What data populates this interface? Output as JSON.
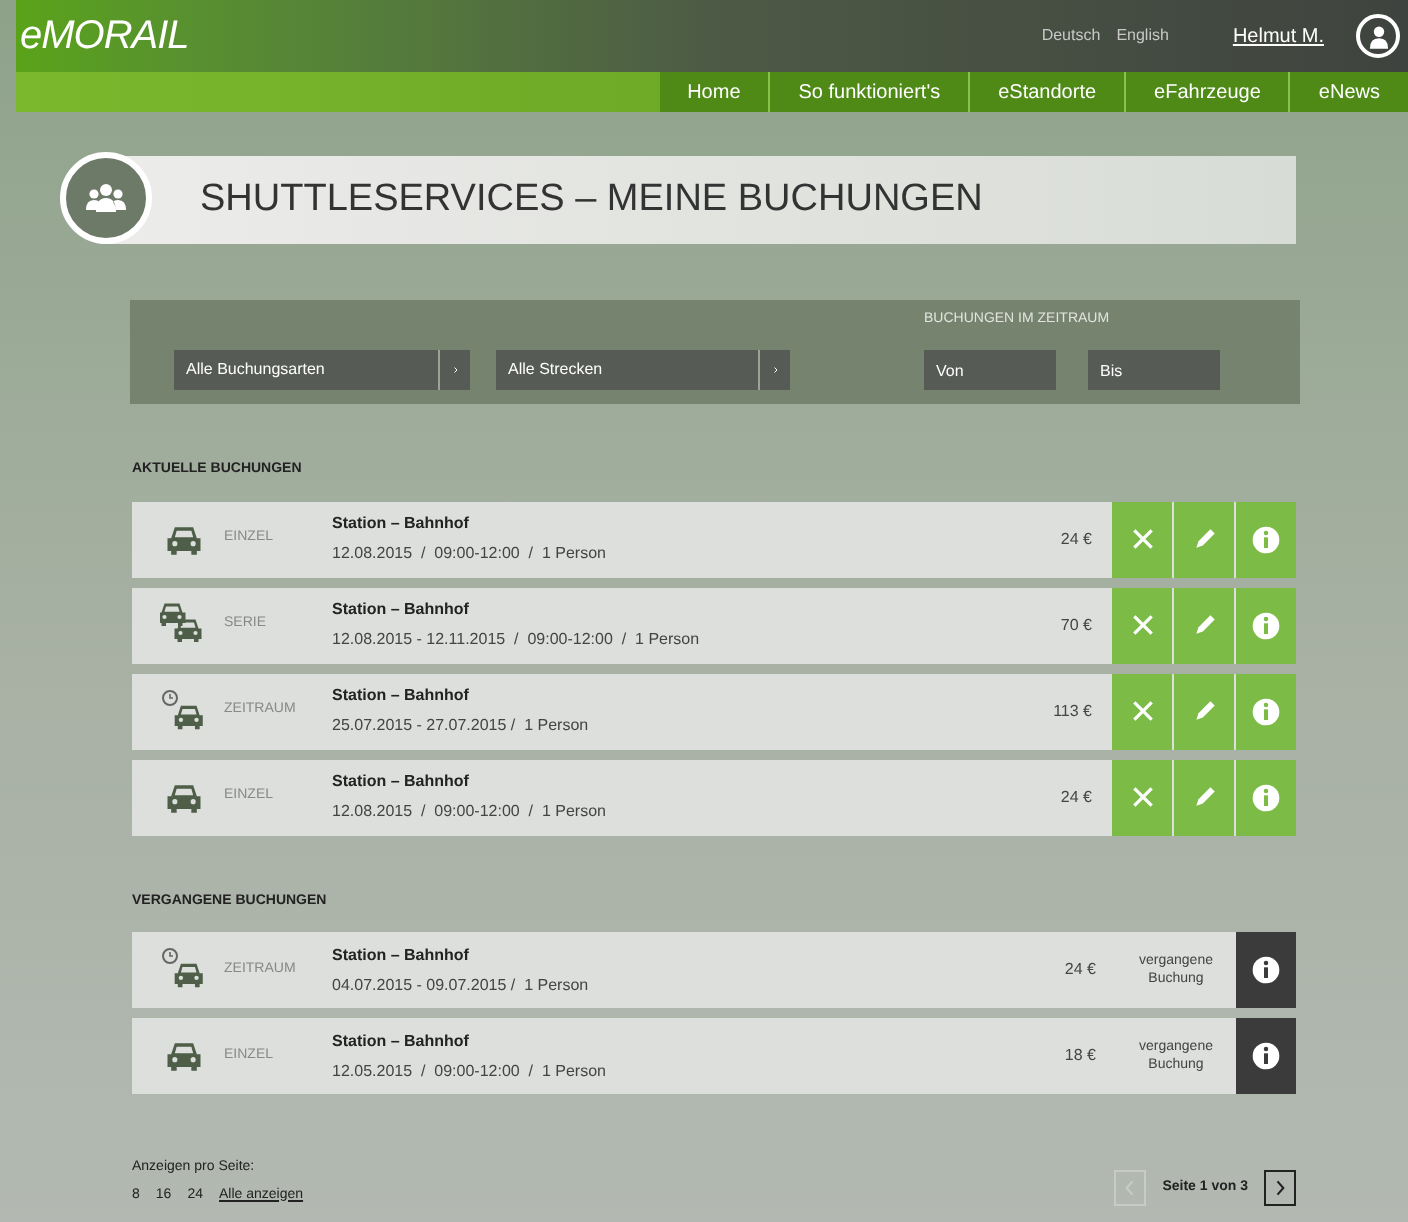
{
  "header": {
    "logo": "eMORAIL",
    "languages": [
      "Deutsch",
      "English"
    ],
    "user": "Helmut M."
  },
  "nav": [
    "Home",
    "So funktioniert's",
    "eStandorte",
    "eFahrzeuge",
    "eNews"
  ],
  "page_title": "SHUTTLESERVICES – MEINE BUCHUNGEN",
  "filters": {
    "booking_type": "Alle Buchungsarten",
    "route": "Alle Strecken",
    "period_label": "BUCHUNGEN IM ZEITRAUM",
    "from_placeholder": "Von",
    "to_placeholder": "Bis"
  },
  "current_bookings": {
    "heading": "AKTUELLE BUCHUNGEN",
    "rows": [
      {
        "kind": "einzel",
        "type": "EINZEL",
        "route": "Station – Bahnhof",
        "details": "12.08.2015  /  09:00-12:00  /  1 Person",
        "price": "24 €"
      },
      {
        "kind": "serie",
        "type": "SERIE",
        "route": "Station – Bahnhof",
        "details": "12.08.2015 - 12.11.2015  /  09:00-12:00  /  1 Person",
        "price": "70 €"
      },
      {
        "kind": "zeitraum",
        "type": "ZEITRAUM",
        "route": "Station – Bahnhof",
        "details": "25.07.2015 - 27.07.2015 /  1 Person",
        "price": "113 €"
      },
      {
        "kind": "einzel",
        "type": "EINZEL",
        "route": "Station – Bahnhof",
        "details": "12.08.2015  /  09:00-12:00  /  1 Person",
        "price": "24 €"
      }
    ]
  },
  "past_bookings": {
    "heading": "VERGANGENE BUCHUNGEN",
    "rows": [
      {
        "kind": "zeitraum",
        "type": "ZEITRAUM",
        "route": "Station – Bahnhof",
        "details": "04.07.2015 - 09.07.2015 /  1 Person",
        "price": "24 €",
        "status": "vergangene Buchung"
      },
      {
        "kind": "einzel",
        "type": "EINZEL",
        "route": "Station – Bahnhof",
        "details": "12.05.2015  /  09:00-12:00  /  1 Person",
        "price": "18 €",
        "status": "vergangene Buchung"
      }
    ]
  },
  "footer": {
    "per_page_label": "Anzeigen pro Seite:",
    "per_page_options": [
      "8",
      "16",
      "24"
    ],
    "show_all": "Alle anzeigen",
    "page_info": "Seite 1 von 3",
    "prev_disabled": true,
    "next_disabled": false
  }
}
